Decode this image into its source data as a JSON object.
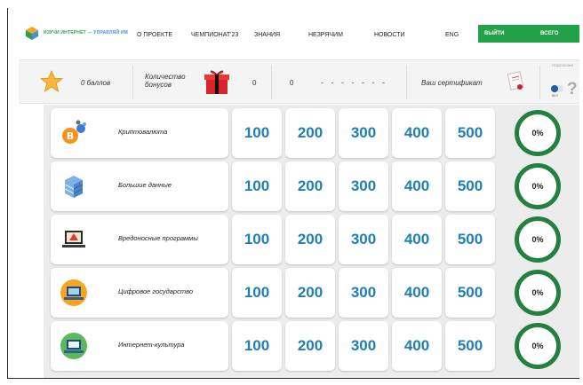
{
  "logo": {
    "text_a": "ИЗУЧИ ИНТЕРНЕТ",
    "text_b": " — УПРАВЛЯЙ ИМ"
  },
  "nav": {
    "items": [
      "О ПРОЕКТЕ",
      "ЧЕМПИОНАТ'23",
      "ЗНАНИЯ",
      "НЕЗРЯЧИМ",
      "НОВОСТИ"
    ],
    "lang": "ENG",
    "logout": "ВЫЙТИ",
    "all": "ВСЕГО"
  },
  "stats": {
    "points": "0 баллов",
    "bonus_label_1": "Количество",
    "bonus_label_2": "бонусов",
    "bonus_count": "0",
    "count2": "0",
    "dashes": "- - - - - - -",
    "certificate": "Ваш сертификат",
    "hint": "ПОДСКАЗКИ",
    "toggle_label": "ВКЛ",
    "help": "?"
  },
  "topics": [
    {
      "name": "Криптовалюта",
      "icon": "bitcoin-icon",
      "progress": "0%"
    },
    {
      "name": "Большие данные",
      "icon": "server-icon",
      "progress": "0%"
    },
    {
      "name": "Вредоносные программы",
      "icon": "laptop-virus-icon",
      "progress": "0%"
    },
    {
      "name": "Цифровое государство",
      "icon": "laptop-gov-icon",
      "progress": "0%"
    },
    {
      "name": "Интернет-культура",
      "icon": "laptop-culture-icon",
      "progress": "0%"
    }
  ],
  "point_values": [
    "100",
    "200",
    "300",
    "400",
    "500"
  ],
  "colors": {
    "accent_green": "#23a148",
    "ring_green": "#23803f",
    "points_blue": "#1e7fb8"
  }
}
